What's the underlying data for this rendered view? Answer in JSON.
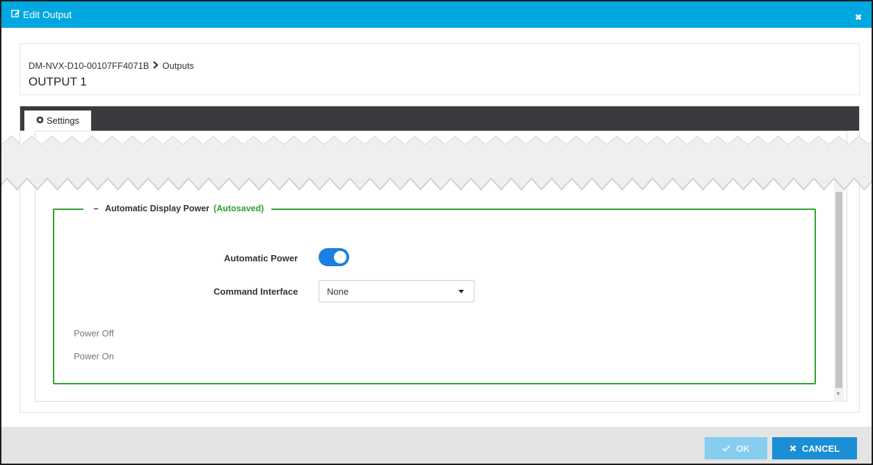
{
  "dialog": {
    "title": "Edit Output",
    "title_icon": "edit-icon",
    "close_icon": "close-icon",
    "close_glyph": "✖"
  },
  "breadcrumb": {
    "device": "DM-NVX-D10-00107FF4071B",
    "separator_icon": "chevron-right-icon",
    "section": "Outputs"
  },
  "page_title": "OUTPUT 1",
  "tabs": [
    {
      "label": "Settings",
      "icon": "gear-icon",
      "active": true
    }
  ],
  "fieldset": {
    "collapse_glyph": "–",
    "title": "Automatic Display Power",
    "status": "(Autosaved)"
  },
  "form": {
    "automatic_power_label": "Automatic Power",
    "automatic_power_on": true,
    "command_interface_label": "Command Interface",
    "command_interface_value": "None",
    "power_off_label": "Power Off",
    "power_on_label": "Power On"
  },
  "footer": {
    "ok_label": "OK",
    "ok_icon": "check-icon",
    "cancel_label": "CANCEL",
    "cancel_icon": "close-icon"
  },
  "colors": {
    "titlebar": "#00a7e1",
    "fieldset_border": "#2ea02e",
    "toggle_on": "#1c7ee0",
    "cancel_button": "#1a8fd6",
    "ok_button_disabled": "#86cdf0",
    "tabbar": "#3a3b3e"
  }
}
